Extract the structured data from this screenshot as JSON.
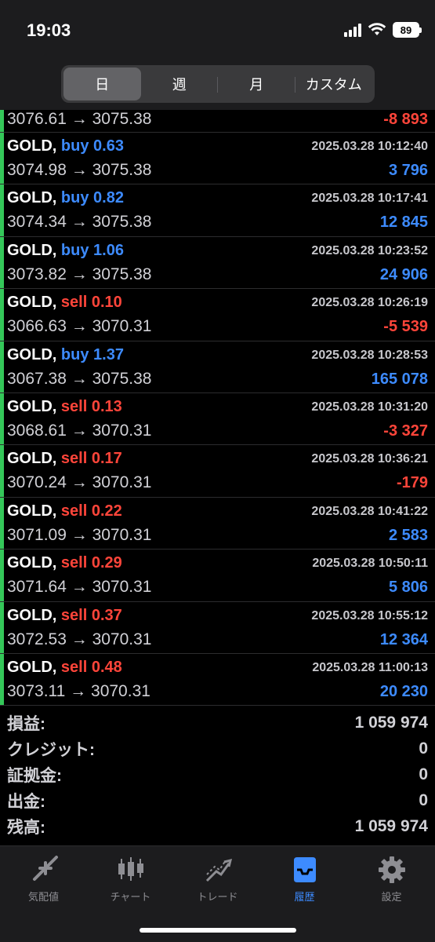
{
  "status": {
    "time": "19:03",
    "battery": "89"
  },
  "segments": [
    {
      "label": "日",
      "active": true
    },
    {
      "label": "週",
      "active": false
    },
    {
      "label": "月",
      "active": false
    },
    {
      "label": "カスタム",
      "active": false
    }
  ],
  "first_row": {
    "prices": "3076.61 → 3075.38",
    "profit": "-8 893"
  },
  "trades": [
    {
      "symbol": "GOLD,",
      "side": "buy",
      "volume": "0.63",
      "time": "2025.03.28 10:12:40",
      "prices": "3074.98 → 3075.38",
      "profit": "3 796",
      "sign": "pos"
    },
    {
      "symbol": "GOLD,",
      "side": "buy",
      "volume": "0.82",
      "time": "2025.03.28 10:17:41",
      "prices": "3074.34 → 3075.38",
      "profit": "12 845",
      "sign": "pos"
    },
    {
      "symbol": "GOLD,",
      "side": "buy",
      "volume": "1.06",
      "time": "2025.03.28 10:23:52",
      "prices": "3073.82 → 3075.38",
      "profit": "24 906",
      "sign": "pos"
    },
    {
      "symbol": "GOLD,",
      "side": "sell",
      "volume": "0.10",
      "time": "2025.03.28 10:26:19",
      "prices": "3066.63 → 3070.31",
      "profit": "-5 539",
      "sign": "neg"
    },
    {
      "symbol": "GOLD,",
      "side": "buy",
      "volume": "1.37",
      "time": "2025.03.28 10:28:53",
      "prices": "3067.38 → 3075.38",
      "profit": "165 078",
      "sign": "pos"
    },
    {
      "symbol": "GOLD,",
      "side": "sell",
      "volume": "0.13",
      "time": "2025.03.28 10:31:20",
      "prices": "3068.61 → 3070.31",
      "profit": "-3 327",
      "sign": "neg"
    },
    {
      "symbol": "GOLD,",
      "side": "sell",
      "volume": "0.17",
      "time": "2025.03.28 10:36:21",
      "prices": "3070.24 → 3070.31",
      "profit": "-179",
      "sign": "neg"
    },
    {
      "symbol": "GOLD,",
      "side": "sell",
      "volume": "0.22",
      "time": "2025.03.28 10:41:22",
      "prices": "3071.09 → 3070.31",
      "profit": "2 583",
      "sign": "pos"
    },
    {
      "symbol": "GOLD,",
      "side": "sell",
      "volume": "0.29",
      "time": "2025.03.28 10:50:11",
      "prices": "3071.64 → 3070.31",
      "profit": "5 806",
      "sign": "pos"
    },
    {
      "symbol": "GOLD,",
      "side": "sell",
      "volume": "0.37",
      "time": "2025.03.28 10:55:12",
      "prices": "3072.53 → 3070.31",
      "profit": "12 364",
      "sign": "pos"
    },
    {
      "symbol": "GOLD,",
      "side": "sell",
      "volume": "0.48",
      "time": "2025.03.28 11:00:13",
      "prices": "3073.11 → 3070.31",
      "profit": "20 230",
      "sign": "pos"
    }
  ],
  "summary": [
    {
      "key": "損益:",
      "value": "1 059 974"
    },
    {
      "key": "クレジット:",
      "value": "0"
    },
    {
      "key": "証拠金:",
      "value": "0"
    },
    {
      "key": "出金:",
      "value": "0"
    },
    {
      "key": "残高:",
      "value": "1 059 974"
    }
  ],
  "tabs": [
    {
      "label": "気配値",
      "icon": "quotes-icon",
      "active": false
    },
    {
      "label": "チャート",
      "icon": "chart-icon",
      "active": false
    },
    {
      "label": "トレード",
      "icon": "trade-icon",
      "active": false
    },
    {
      "label": "履歴",
      "icon": "history-icon",
      "active": true
    },
    {
      "label": "設定",
      "icon": "settings-icon",
      "active": false
    }
  ],
  "colors": {
    "buy": "#3d8bff",
    "sell": "#ff453a",
    "accent_bar": "#34c759",
    "active_tab": "#3d8bff"
  }
}
